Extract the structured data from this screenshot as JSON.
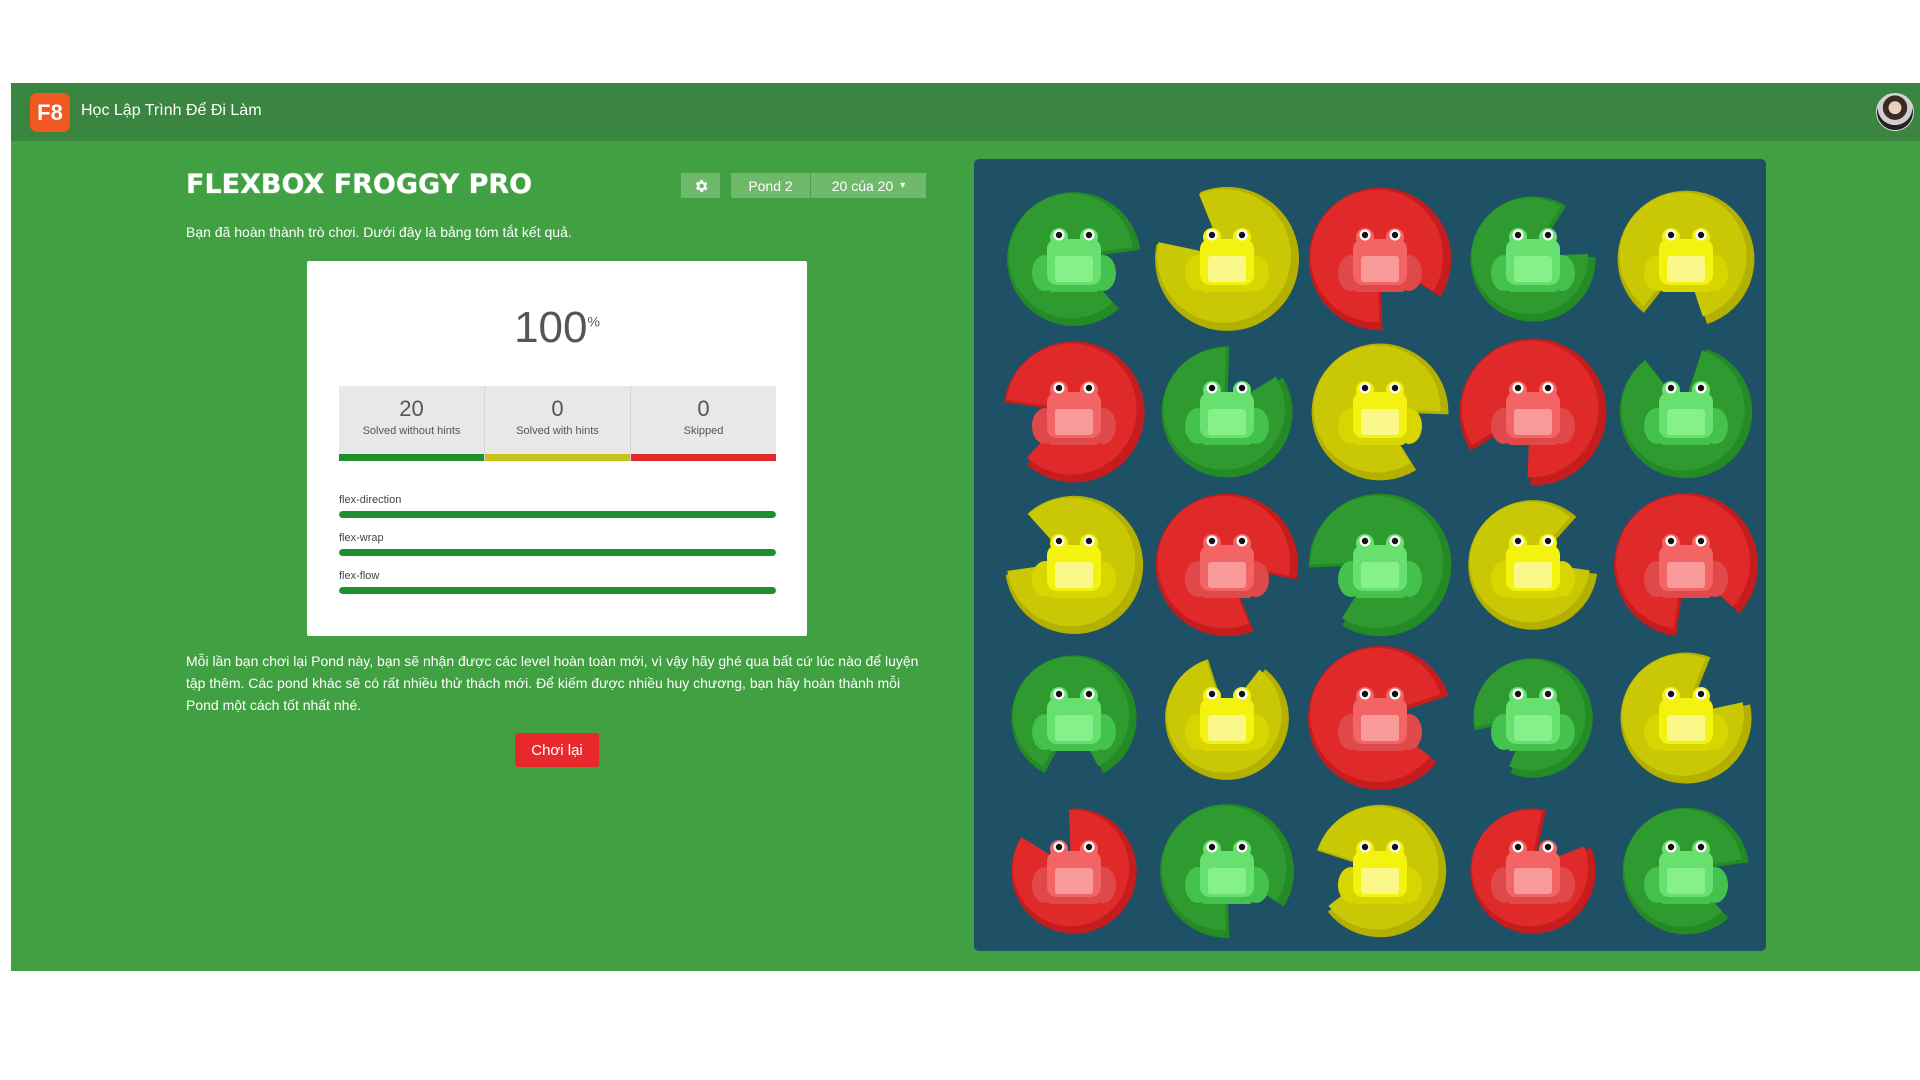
{
  "header": {
    "logo_text": "F8",
    "brand": "Học Lập Trình Để Đi Làm",
    "avatar_icon": "user-avatar"
  },
  "game": {
    "title": "FLEXBOX FROGGY PRO",
    "settings_icon": "gear-icon",
    "pond_label": "Pond 2",
    "level_label": "20 của 20",
    "level_caret": "▾",
    "summary": "Bạn đã hoàn thành trò chơi. Dưới đây là bảng tóm tắt kết quả."
  },
  "results": {
    "score": "100",
    "score_unit": "%",
    "stats": [
      {
        "value": "20",
        "label": "Solved without hints",
        "color": "#1e8f2d"
      },
      {
        "value": "0",
        "label": "Solved with hints",
        "color": "#c8c21b"
      },
      {
        "value": "0",
        "label": "Skipped",
        "color": "#e02a2a"
      }
    ],
    "properties": [
      {
        "name": "flex-direction",
        "progress": 1.0
      },
      {
        "name": "flex-wrap",
        "progress": 1.0
      },
      {
        "name": "flex-flow",
        "progress": 1.0
      }
    ]
  },
  "info_text": "Mỗi lần bạn chơi lại Pond này, bạn sẽ nhận được các level hoàn toàn mới, vì vậy hãy ghé qua bất cứ lúc nào để luyện tập thêm. Các pond khác sẽ có rất nhiều thử thách mới. Để kiếm được nhiều huy chương, bạn hãy hoàn thành mỗi Pond một cách tốt nhất nhé.",
  "replay_label": "Chơi lại",
  "colors": {
    "green": {
      "pad": "#2f9a2f",
      "padDark": "#238a26",
      "frog": "#67e06f",
      "frogDark": "#43c24d",
      "belly": "#86f08b"
    },
    "yellow": {
      "pad": "#cac704",
      "padDark": "#b3b000",
      "frog": "#f4f20f",
      "frogDark": "#d9d500",
      "belly": "#f9f889"
    },
    "red": {
      "pad": "#e02a2a",
      "padDark": "#c51d1d",
      "frog": "#f36565",
      "frogDark": "#e04949",
      "belly": "#f99a9a"
    }
  },
  "pond": {
    "rows": [
      [
        "green",
        "yellow",
        "red",
        "green",
        "yellow"
      ],
      [
        "red",
        "green",
        "yellow",
        "red",
        "green"
      ],
      [
        "yellow",
        "red",
        "green",
        "yellow",
        "red"
      ],
      [
        "green",
        "yellow",
        "red",
        "green",
        "yellow"
      ],
      [
        "red",
        "green",
        "yellow",
        "red",
        "green"
      ]
    ]
  }
}
